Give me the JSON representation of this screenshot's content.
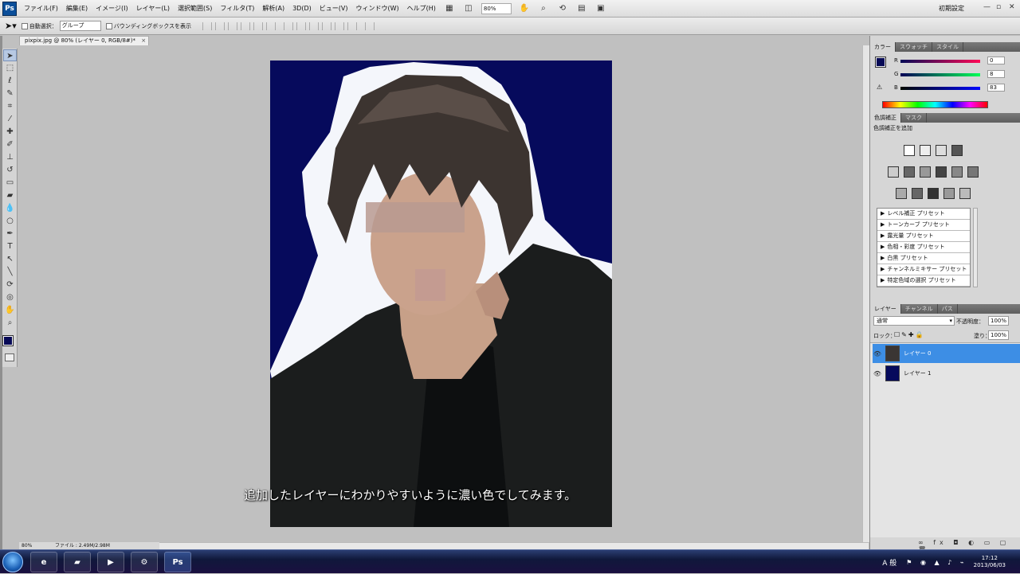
{
  "menubar": {
    "logo": "Ps",
    "items": [
      "ファイル(F)",
      "編集(E)",
      "イメージ(I)",
      "レイヤー(L)",
      "選択範囲(S)",
      "フィルタ(T)",
      "解析(A)",
      "3D(D)",
      "ビュー(V)",
      "ウィンドウ(W)",
      "ヘルプ(H)"
    ],
    "zoom": "80%",
    "workspace": "初期設定"
  },
  "options": {
    "auto_select_label": "自動選択：",
    "auto_select_value": "グループ",
    "bounding_box_label": "バウンディングボックスを表示"
  },
  "document": {
    "tab_title": "pixpix.jpg @ 80% (レイヤー 0, RGB/8#)",
    "tab_modified": "*",
    "close": "×"
  },
  "status": {
    "zoom": "80%",
    "file_info": "ファイル : 2.49M/2.98M"
  },
  "subtitle": "追加したレイヤーにわかりやすいように濃い色でしてみます。",
  "color_panel": {
    "tabs": [
      "カラー",
      "スウォッチ",
      "スタイル"
    ],
    "fg_color": "#070a56",
    "channels": [
      {
        "label": "R",
        "value": "0"
      },
      {
        "label": "G",
        "value": "8"
      },
      {
        "label": "B",
        "value": "83"
      }
    ]
  },
  "adjust_panel": {
    "tabs": [
      "色調補正",
      "マスク"
    ],
    "title": "色調補正を追加",
    "presets": [
      "レベル補正 プリセット",
      "トーンカーブ プリセット",
      "露光量 プリセット",
      "色相・彩度 プリセット",
      "白黒 プリセット",
      "チャンネルミキサー プリセット",
      "特定色域の選択 プリセット"
    ]
  },
  "layers_panel": {
    "tabs": [
      "レイヤー",
      "チャンネル",
      "パス"
    ],
    "blend_mode": "通常",
    "opacity_label": "不透明度：",
    "opacity": "100%",
    "lock_label": "ロック：",
    "fill_label": "塗り：",
    "fill": "100%",
    "layers": [
      {
        "name": "レイヤー 0",
        "selected": true
      },
      {
        "name": "レイヤー 1",
        "selected": false
      }
    ]
  },
  "taskbar": {
    "ps_label": "Ps",
    "tray_lang": "A 般",
    "time": "17:12",
    "date": "2013/06/03"
  },
  "colors": {
    "doc_background": "#060a5c",
    "layer_selected": "#3d8ee5"
  }
}
